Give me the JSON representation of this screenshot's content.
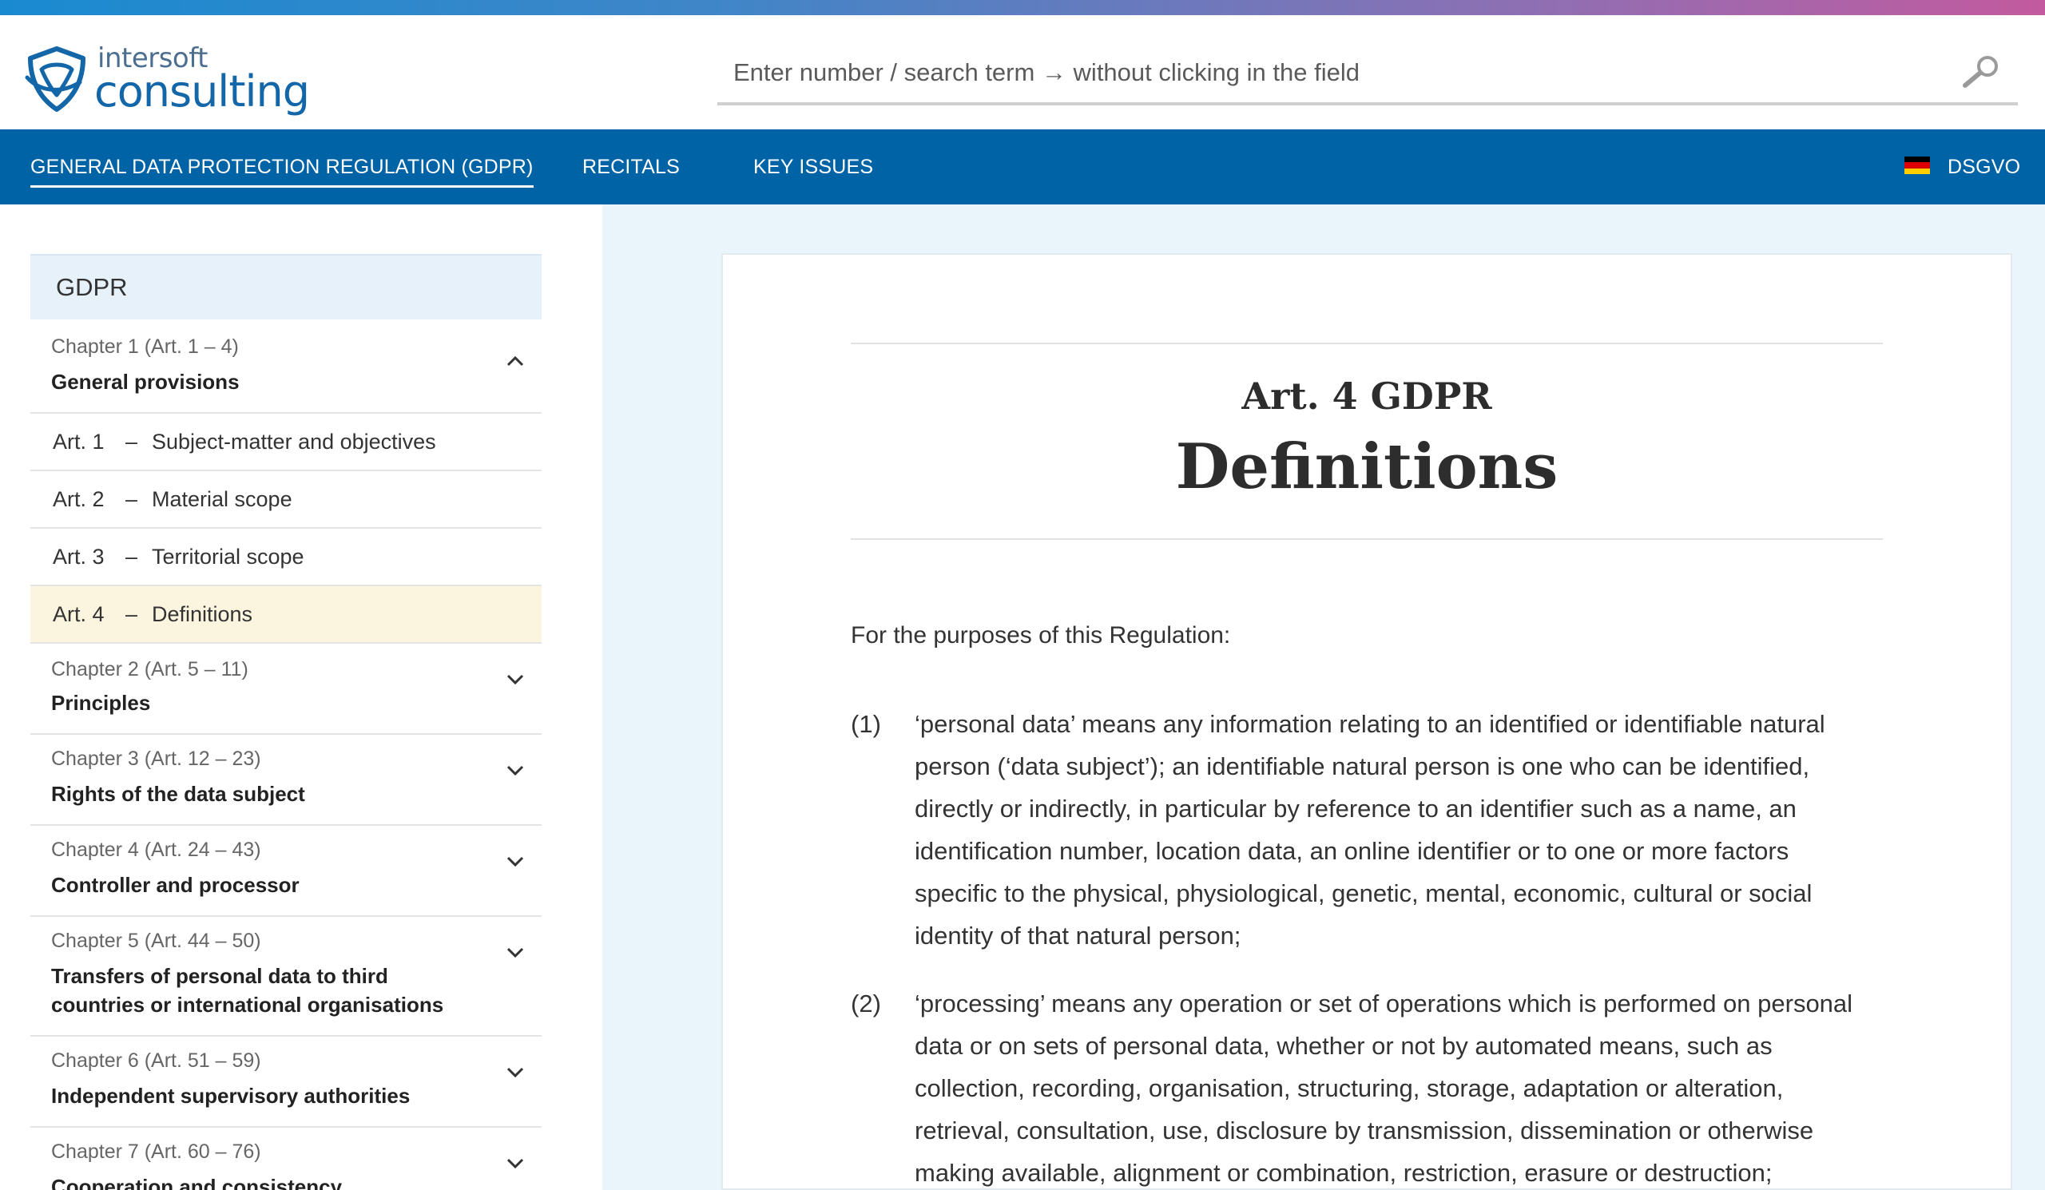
{
  "brand": {
    "logo_line1": "intersoft",
    "logo_line2": "consulting",
    "accent": "#0063a6"
  },
  "search": {
    "placeholder": "Enter number / search term → without clicking in the field"
  },
  "nav": {
    "items": [
      {
        "label": "GENERAL DATA PROTECTION REGULATION (GDPR)",
        "active": true
      },
      {
        "label": "RECITALS"
      },
      {
        "label": "KEY ISSUES"
      }
    ],
    "language_label": "DSGVO",
    "flag_colors": [
      "#000000",
      "#dd0000",
      "#ffce00"
    ]
  },
  "sidebar": {
    "heading": "GDPR",
    "chapters": [
      {
        "num": "Chapter 1 (Art. 1 – 4)",
        "title": "General provisions",
        "expanded": true
      },
      {
        "num": "Chapter 2 (Art. 5 – 11)",
        "title": "Principles"
      },
      {
        "num": "Chapter 3 (Art. 12 – 23)",
        "title": "Rights of the data subject"
      },
      {
        "num": "Chapter 4 (Art. 24 – 43)",
        "title": "Controller and processor"
      },
      {
        "num": "Chapter 5 (Art. 44 – 50)",
        "title_line1": "Transfers of personal data to third",
        "title_line2": "countries or international organisations"
      },
      {
        "num": "Chapter 6 (Art. 51 – 59)",
        "title": "Independent supervisory authorities"
      },
      {
        "num": "Chapter 7 (Art. 60 – 76)",
        "title": "Cooperation and consistency"
      }
    ],
    "articles": [
      {
        "num": "Art. 1",
        "dash": "–",
        "label": "Subject-matter and objectives"
      },
      {
        "num": "Art. 2",
        "dash": "–",
        "label": "Material scope"
      },
      {
        "num": "Art. 3",
        "dash": "–",
        "label": "Territorial scope"
      },
      {
        "num": "Art. 4",
        "dash": "–",
        "label": "Definitions",
        "active": true
      }
    ]
  },
  "article": {
    "subtitle": "Art. 4 GDPR",
    "title": "Definitions",
    "intro": "For the purposes of this Regulation:",
    "paragraphs": [
      {
        "num": "(1)",
        "lines": [
          "‘personal data’ means any information relating to an identified or identifiable natural",
          "person (‘data subject’); an identifiable natural person is one who can be identified,",
          "directly or indirectly, in particular by reference to an identifier such as a name, an",
          "identification number, location data, an online identifier or to one or more factors",
          "specific to the physical, physiological, genetic, mental, economic, cultural or social",
          "identity of that natural person;"
        ]
      },
      {
        "num": "(2)",
        "lines": [
          "‘processing’ means any operation or set of operations which is performed on personal",
          "data or on sets of personal data, whether or not by automated means, such as",
          "collection, recording, organisation, structuring, storage, adaptation or alteration,",
          "retrieval, consultation, use, disclosure by transmission, dissemination or otherwise",
          "making available, alignment or combination, restriction, erasure or destruction;"
        ]
      }
    ]
  }
}
